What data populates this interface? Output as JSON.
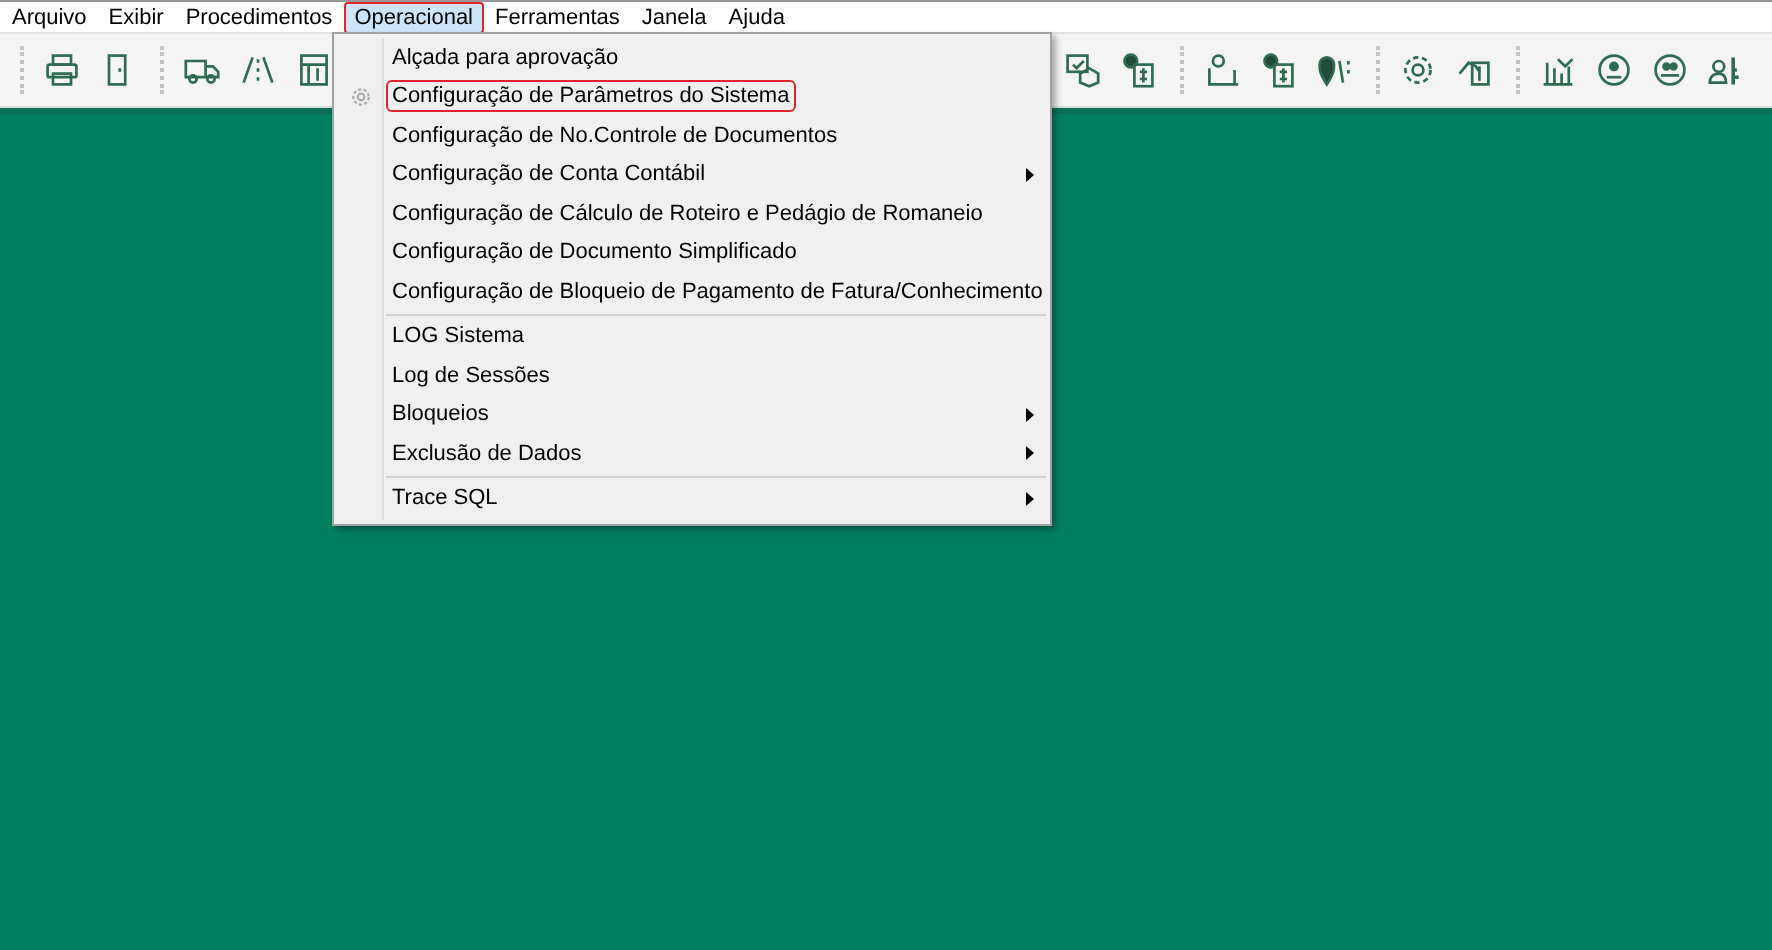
{
  "menu_bar": [
    {
      "label": "Arquivo",
      "selected": false,
      "marked": false
    },
    {
      "label": "Exibir",
      "selected": false,
      "marked": false
    },
    {
      "label": "Procedimentos",
      "selected": false,
      "marked": false
    },
    {
      "label": "Operacional",
      "selected": true,
      "marked": true
    },
    {
      "label": "Ferramentas",
      "selected": false,
      "marked": false
    },
    {
      "label": "Janela",
      "selected": false,
      "marked": false
    },
    {
      "label": "Ajuda",
      "selected": false,
      "marked": false
    }
  ],
  "dropdown": {
    "groups": [
      [
        {
          "label": "Alçada para aprovação",
          "submenu": false,
          "marked": false,
          "icon": false
        },
        {
          "label": "Configuração de Parâmetros do Sistema",
          "submenu": false,
          "marked": true,
          "icon": true
        },
        {
          "label": "Configuração de No.Controle de Documentos",
          "submenu": false,
          "marked": false,
          "icon": false
        },
        {
          "label": "Configuração de Conta Contábil",
          "submenu": true,
          "marked": false,
          "icon": false
        },
        {
          "label": "Configuração de Cálculo de Roteiro e Pedágio de Romaneio",
          "submenu": false,
          "marked": false,
          "icon": false
        },
        {
          "label": "Configuração de Documento Simplificado",
          "submenu": false,
          "marked": false,
          "icon": false
        },
        {
          "label": "Configuração de Bloqueio de Pagamento de Fatura/Conhecimento",
          "submenu": false,
          "marked": false,
          "icon": false
        }
      ],
      [
        {
          "label": "LOG Sistema",
          "submenu": false,
          "marked": false,
          "icon": false
        },
        {
          "label": "Log de Sessões",
          "submenu": false,
          "marked": false,
          "icon": false
        },
        {
          "label": "Bloqueios",
          "submenu": true,
          "marked": false,
          "icon": false
        },
        {
          "label": "Exclusão de Dados",
          "submenu": true,
          "marked": false,
          "icon": false
        }
      ],
      [
        {
          "label": "Trace SQL",
          "submenu": true,
          "marked": false,
          "icon": false
        }
      ]
    ]
  }
}
